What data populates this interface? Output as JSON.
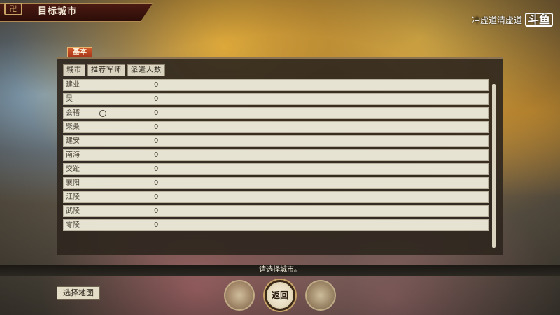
{
  "header": {
    "title": "目标城市",
    "emblem_icon": "ornament-icon"
  },
  "watermark": {
    "text": "冲虚道清虚道",
    "logo": "斗鱼"
  },
  "panel": {
    "tab_label": "基本",
    "columns": [
      "城市",
      "推荐军师",
      "派遣人数"
    ],
    "rows": [
      {
        "city": "建业",
        "count": "0",
        "recommended": false
      },
      {
        "city": "吴",
        "count": "0",
        "recommended": false
      },
      {
        "city": "会稽",
        "count": "0",
        "recommended": true
      },
      {
        "city": "柴桑",
        "count": "0",
        "recommended": false
      },
      {
        "city": "建安",
        "count": "0",
        "recommended": false
      },
      {
        "city": "南海",
        "count": "0",
        "recommended": false
      },
      {
        "city": "交趾",
        "count": "0",
        "recommended": false
      },
      {
        "city": "襄阳",
        "count": "0",
        "recommended": false
      },
      {
        "city": "江陵",
        "count": "0",
        "recommended": false
      },
      {
        "city": "武陵",
        "count": "0",
        "recommended": false
      },
      {
        "city": "零陵",
        "count": "0",
        "recommended": false
      }
    ]
  },
  "message": "请选择城市。",
  "footer": {
    "select_map_label": "选择地图",
    "return_label": "返回"
  },
  "colors": {
    "tab_accent": "#c24a22",
    "row_bg": "#e7e3d3",
    "panel_bg": "#2d261e"
  }
}
